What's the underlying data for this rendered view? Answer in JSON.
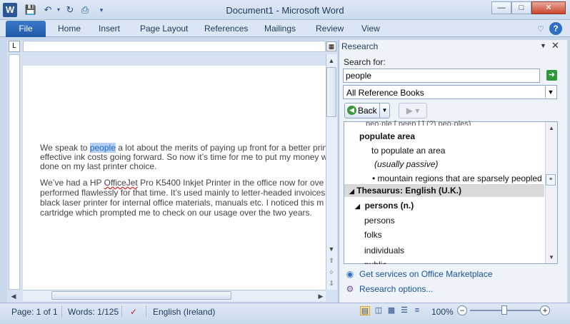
{
  "window": {
    "title": "Document1 - Microsoft Word",
    "app_icon": "W"
  },
  "quick_access": {
    "save": "save-icon",
    "undo": "undo-icon",
    "redo": "redo-icon",
    "print": "print-icon"
  },
  "ribbon": {
    "file": "File",
    "tabs": [
      "Home",
      "Insert",
      "Page Layout",
      "References",
      "Mailings",
      "Review",
      "View"
    ]
  },
  "document": {
    "p1": [
      "We speak to ",
      "people",
      " a lot about the merits of paying up front for a better prin",
      "effective ink costs going forward. So now it’s time for me to  put my money w",
      "done on my last printer choice."
    ],
    "p2": [
      "We’ve had a HP ",
      "OfficeJet",
      " Pro K5400 Inkjet Printer in the office now for ove",
      "performed flawlessly for that time. It’s used mainly to letter-headed invoices",
      "black laser printer for internal office materials, manuals etc. I noticed this m",
      "cartridge which prompted me to check on our usage over the two years."
    ]
  },
  "research": {
    "title": "Research",
    "search_label": "Search for:",
    "search_value": "people",
    "source": "All Reference Books",
    "back": "Back",
    "results": {
      "cut": "peo·ple [ peep l ] (?) peo·ples)",
      "heading1": "populate area",
      "line1": "to populate an area",
      "line2": "(usually passive)",
      "line3": "mountain regions that are sparsely peopled",
      "thesaurus": "Thesaurus: English (U.K.)",
      "heading2": "persons (n.)",
      "syn1": "persons",
      "syn2": "folks",
      "syn3": "individuals",
      "syn4": "public"
    },
    "link_market": "Get services on Office Marketplace",
    "link_options": "Research options..."
  },
  "status": {
    "page": "Page: 1 of 1",
    "words": "Words: 1/125",
    "language": "English (Ireland)",
    "zoom": "100%"
  },
  "colors": {
    "accent": "#1f5aa8",
    "highlight": "#b6cff0"
  }
}
